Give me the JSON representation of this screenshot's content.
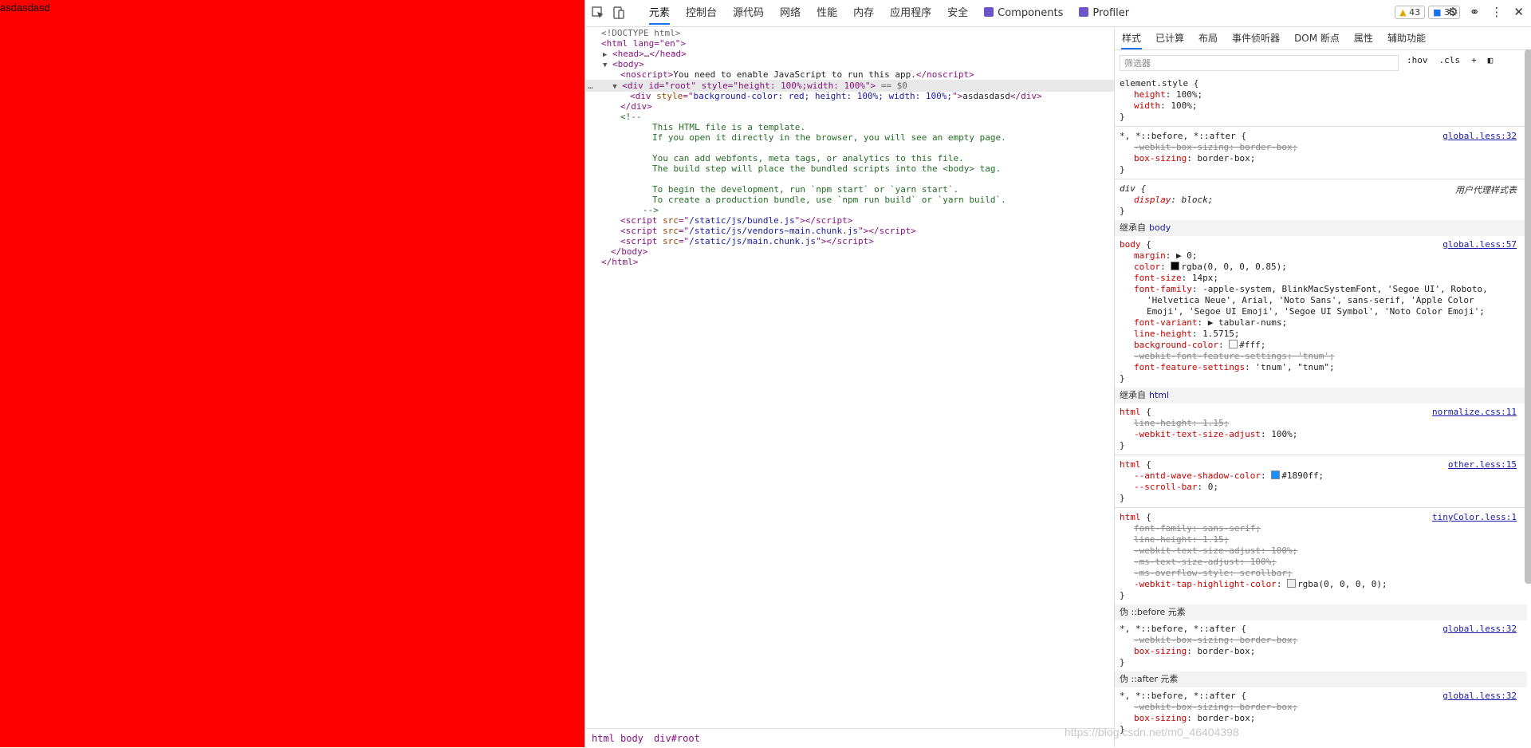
{
  "page": {
    "text": "asdasdasd",
    "background": "#ff0000"
  },
  "devtools": {
    "tabs": [
      {
        "label": "元素"
      },
      {
        "label": "控制台"
      },
      {
        "label": "源代码"
      },
      {
        "label": "网络"
      },
      {
        "label": "性能"
      },
      {
        "label": "内存"
      },
      {
        "label": "应用程序"
      },
      {
        "label": "安全"
      },
      {
        "label": "Components"
      },
      {
        "label": "Profiler"
      }
    ],
    "warnings_count": "43",
    "messages_count": "35",
    "elements": {
      "doctype": "<!DOCTYPE html>",
      "html_open": "<html lang=\"en\">",
      "head": "<head>…</head>",
      "body_open": "<body>",
      "noscript": "You need to enable JavaScript to run this app.",
      "root_div": "<div id=\"root\" style=\"height: 100%;width: 100%\">",
      "root_marker": "== $0",
      "inner_div_style": "background-color: red; height: 100%; width: 100%;",
      "inner_div_text": "asdasdasd",
      "div_close": "</div>",
      "comment_open": "<!--",
      "comment_lines": [
        "This HTML file is a template.",
        "If you open it directly in the browser, you will see an empty page.",
        "",
        "You can add webfonts, meta tags, or analytics to this file.",
        "The build step will place the bundled scripts into the <body> tag.",
        "",
        "To begin the development, run `npm start` or `yarn start`.",
        "To create a production bundle, use `npm run build` or `yarn build`."
      ],
      "comment_close": "-->",
      "scripts": [
        "/static/js/bundle.js",
        "/static/js/vendors~main.chunk.js",
        "/static/js/main.chunk.js"
      ],
      "body_close": "</body>",
      "html_close": "</html>"
    },
    "breadcrumbs": [
      "html",
      "body",
      "div#root"
    ],
    "styles": {
      "tabs": [
        {
          "label": "样式"
        },
        {
          "label": "已计算"
        },
        {
          "label": "布局"
        },
        {
          "label": "事件侦听器"
        },
        {
          "label": "DOM 断点"
        },
        {
          "label": "属性"
        },
        {
          "label": "辅助功能"
        }
      ],
      "filter_placeholder": "筛选器",
      "hov": ":hov",
      "cls": ".cls",
      "element_style": "element.style {",
      "inherited_body": "继承自",
      "inherited_body_tag": "body",
      "inherited_html": "继承自",
      "inherited_html_tag": "html",
      "pseudo_before": "伪 ::before 元素",
      "pseudo_after": "伪 ::after 元素",
      "user_agent": "用户代理样式表",
      "sources": {
        "global32": "global.less:32",
        "global57": "global.less:57",
        "normalize": "normalize.css:11",
        "other": "other.less:15",
        "tinycolor": "tinyColor.less:1"
      },
      "colors": {
        "text_swatch": "#000000",
        "bg_swatch": "#ffffff",
        "antd_swatch": "#1890ff"
      }
    }
  },
  "watermark": "https://blog.csdn.net/m0_46404398"
}
